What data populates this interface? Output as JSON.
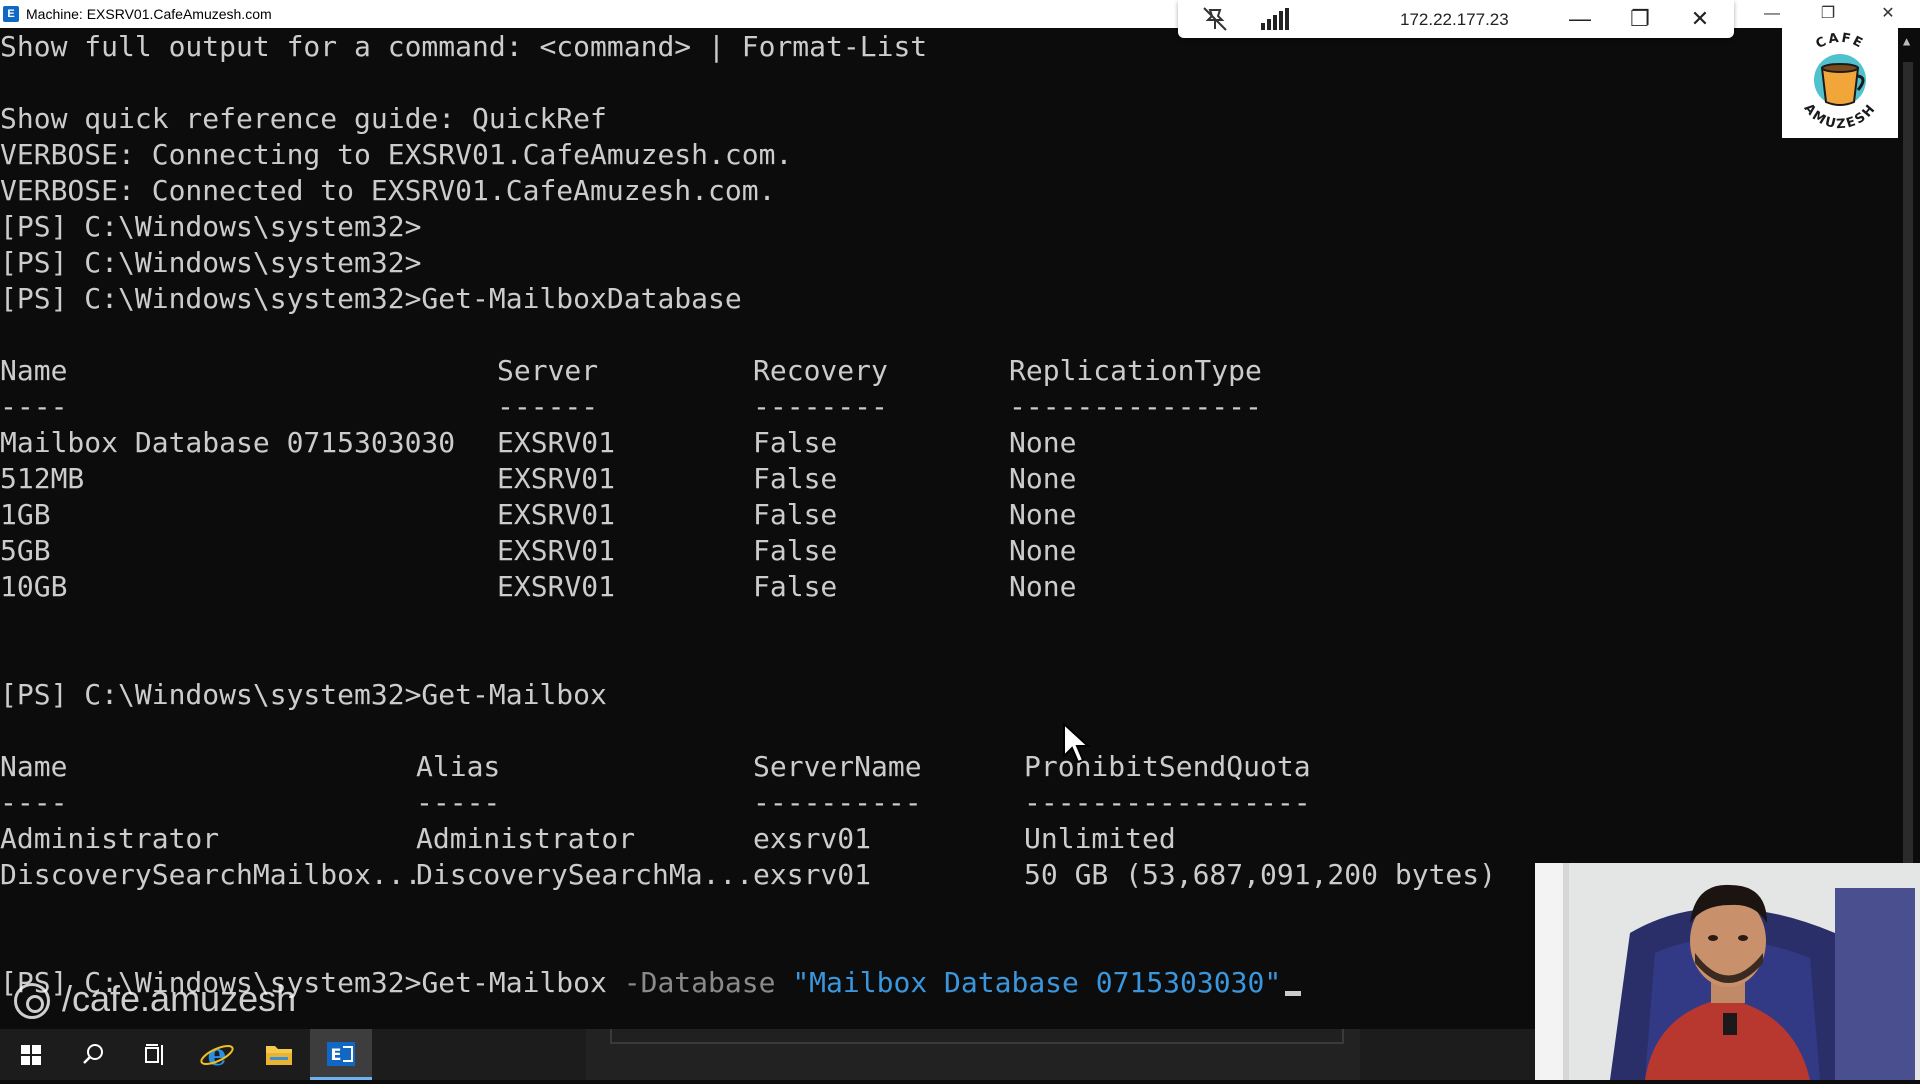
{
  "window": {
    "title": "Machine: EXSRV01.CafeAmuzesh.com",
    "app_icon": "E",
    "minimize": "—",
    "restore": "❐",
    "close": "✕"
  },
  "rdp_bar": {
    "ip": "172.22.177.23",
    "pin_icon": "unpin-icon",
    "signal_icon": "signal-bars-icon",
    "minimize": "—",
    "restore": "❐",
    "close": "✕"
  },
  "logo": {
    "text_top": "CAFE",
    "text_bottom": "AMUZESH",
    "colors": {
      "cup": "#f2a63a",
      "steam": "#30b7c5",
      "text": "#1a1a1a"
    }
  },
  "terminal": {
    "colors": {
      "background": "#0c0c0c",
      "text": "#cccccc",
      "parameter": "#8a8a8a",
      "string": "#3a96dd"
    },
    "intro_lines": [
      "Show full output for a command: <command> | Format-List",
      "",
      "Show quick reference guide: QuickRef",
      "VERBOSE: Connecting to EXSRV01.CafeAmuzesh.com.",
      "VERBOSE: Connected to EXSRV01.CafeAmuzesh.com.",
      "[PS] C:\\Windows\\system32>",
      "[PS] C:\\Windows\\system32>",
      "[PS] C:\\Windows\\system32>Get-MailboxDatabase"
    ],
    "db_table": {
      "headers": [
        "Name",
        "Server",
        "Recovery",
        "ReplicationType"
      ],
      "separators": [
        "----",
        "------",
        "--------",
        "---------------"
      ],
      "rows": [
        [
          "Mailbox Database 0715303030",
          "EXSRV01",
          "False",
          "None"
        ],
        [
          "512MB",
          "EXSRV01",
          "False",
          "None"
        ],
        [
          "1GB",
          "EXSRV01",
          "False",
          "None"
        ],
        [
          "5GB",
          "EXSRV01",
          "False",
          "None"
        ],
        [
          "10GB",
          "EXSRV01",
          "False",
          "None"
        ]
      ]
    },
    "get_mailbox_prompt": "[PS] C:\\Windows\\system32>Get-Mailbox",
    "mailbox_table": {
      "headers": [
        "Name",
        "Alias",
        "ServerName",
        "ProhibitSendQuota"
      ],
      "separators": [
        "----",
        "-----",
        "----------",
        "-----------------"
      ],
      "rows": [
        [
          "Administrator",
          "Administrator",
          "exsrv01",
          "Unlimited"
        ],
        [
          "DiscoverySearchMailbox...",
          "DiscoverySearchMa...",
          "exsrv01",
          "50 GB (53,687,091,200 bytes)"
        ]
      ]
    },
    "current_command": {
      "prompt": "[PS] C:\\Windows\\system32>",
      "cmdlet": "Get-Mailbox",
      "parameter": "-Database",
      "argument": "\"Mailbox Database 0715303030\""
    }
  },
  "watermark": {
    "handle": "/cafe.amuzesh",
    "icon": "instagram-icon"
  },
  "taskbar": {
    "items": [
      {
        "name": "start",
        "icon": "windows-start-icon"
      },
      {
        "name": "search",
        "icon": "search-icon"
      },
      {
        "name": "task-view",
        "icon": "task-view-icon"
      },
      {
        "name": "internet-explorer",
        "icon": "internet-explorer-icon"
      },
      {
        "name": "file-explorer",
        "icon": "folder-icon"
      },
      {
        "name": "exchange-shell",
        "icon": "exchange-icon",
        "active": true
      }
    ],
    "colors": {
      "background": "#1c1c1c",
      "active": "#3d3d3d",
      "accent": "#6cb3f0"
    }
  }
}
